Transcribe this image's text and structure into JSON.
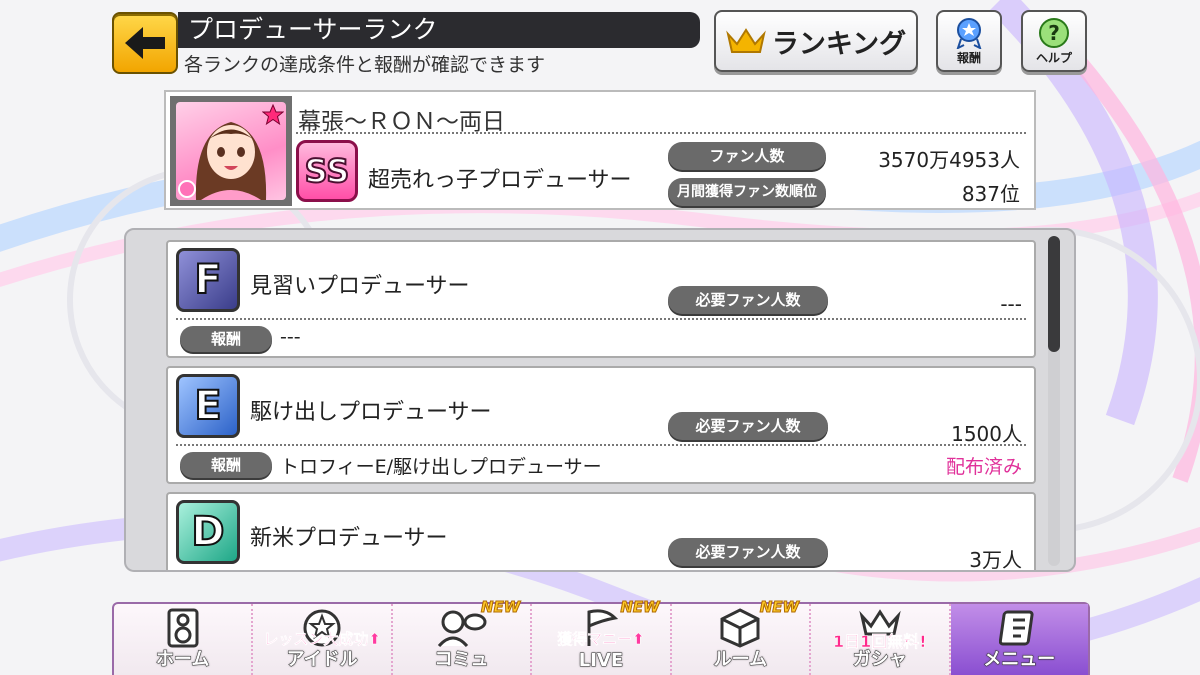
{
  "header": {
    "title": "プロデューサーランク",
    "subtitle": "各ランクの達成条件と報酬が確認できます",
    "ranking_label": "ランキング",
    "reward_label": "報酬",
    "help_label": "ヘルプ"
  },
  "profile": {
    "producer_name": "幕張～ＲＯＮ～両日",
    "rank_badge": "SS",
    "rank_title": "超売れっ子プロデューサー",
    "fan_count_label": "ファン人数",
    "fan_count_value": "3570万4953人",
    "monthly_rank_label": "月間獲得ファン数順位",
    "monthly_rank_value": "837位"
  },
  "ranks": [
    {
      "letter": "F",
      "title": "見習いプロデューサー",
      "required_label": "必要ファン人数",
      "required_value": "---",
      "reward_label": "報酬",
      "reward_text": "---",
      "status": ""
    },
    {
      "letter": "E",
      "title": "駆け出しプロデューサー",
      "required_label": "必要ファン人数",
      "required_value": "1500人",
      "reward_label": "報酬",
      "reward_text": "トロフィーE/駆け出しプロデューサー",
      "status": "配布済み"
    },
    {
      "letter": "D",
      "title": "新米プロデューサー",
      "required_label": "必要ファン人数",
      "required_value": "3万人"
    }
  ],
  "nav": {
    "items": [
      {
        "label": "ホーム",
        "icon": "speaker-icon"
      },
      {
        "label": "アイドル",
        "icon": "star-icon",
        "promo": "レッスン大成功⬆"
      },
      {
        "label": "コミュ",
        "icon": "person-chat-icon",
        "badge": "NEW"
      },
      {
        "label": "LIVE",
        "icon": "flag-icon",
        "badge": "NEW",
        "promo": "獲得マニー⬆"
      },
      {
        "label": "ルーム",
        "icon": "cube-icon",
        "badge": "NEW"
      },
      {
        "label": "ガシャ",
        "icon": "crown-icon",
        "promo": "1日1回無料!"
      },
      {
        "label": "メニュー",
        "icon": "menu-icon"
      }
    ]
  },
  "colors": {
    "accent_pink": "#e0319a",
    "header_dark": "#2b2b2f",
    "back_yellow": "#f2a500",
    "menu_purple": "#8a4fd1"
  }
}
